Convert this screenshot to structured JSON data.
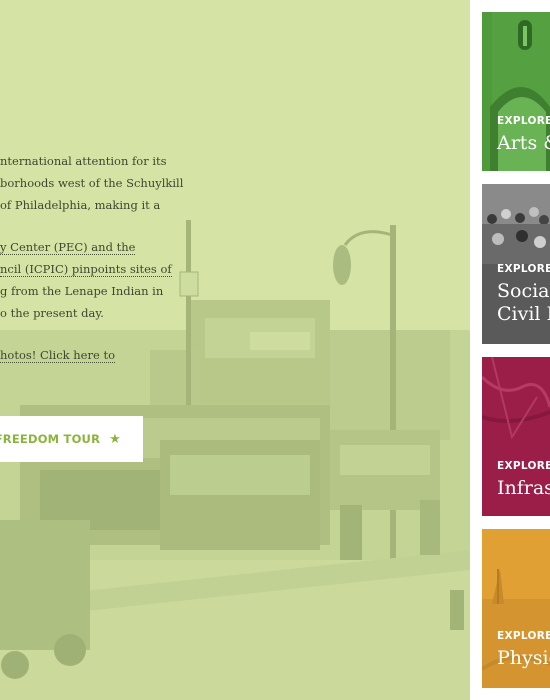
{
  "hero": {
    "paragraphs": [
      [
        "nternational attention for its",
        "borhoods west of the Schuylkill",
        "of Philadelphia, making it a"
      ],
      [
        "y Center (PEC) and the",
        "ncil (ICPIC) pinpoints sites of",
        "g from the Lenape Indian in",
        "o the present day."
      ],
      [
        "hotos! Click here to"
      ]
    ],
    "tour_button": "W FREEDOM TOUR",
    "tour_star": "★",
    "bg_color": "#d5e3a4",
    "text_color": "#3e4630",
    "accent_color": "#8ab43c"
  },
  "cards": [
    {
      "explore": "EXPLORE",
      "title_lines": [
        "Arts &"
      ],
      "color": "#4f9a3b"
    },
    {
      "explore": "EXPLORE",
      "title_lines": [
        "Social",
        "Civil R"
      ],
      "color": "#5f5f5f"
    },
    {
      "explore": "EXPLORE",
      "title_lines": [
        "Infras"
      ],
      "color": "#9c1f4a"
    },
    {
      "explore": "EXPLORE",
      "title_lines": [
        "Physic"
      ],
      "color": "#e0a034"
    }
  ]
}
